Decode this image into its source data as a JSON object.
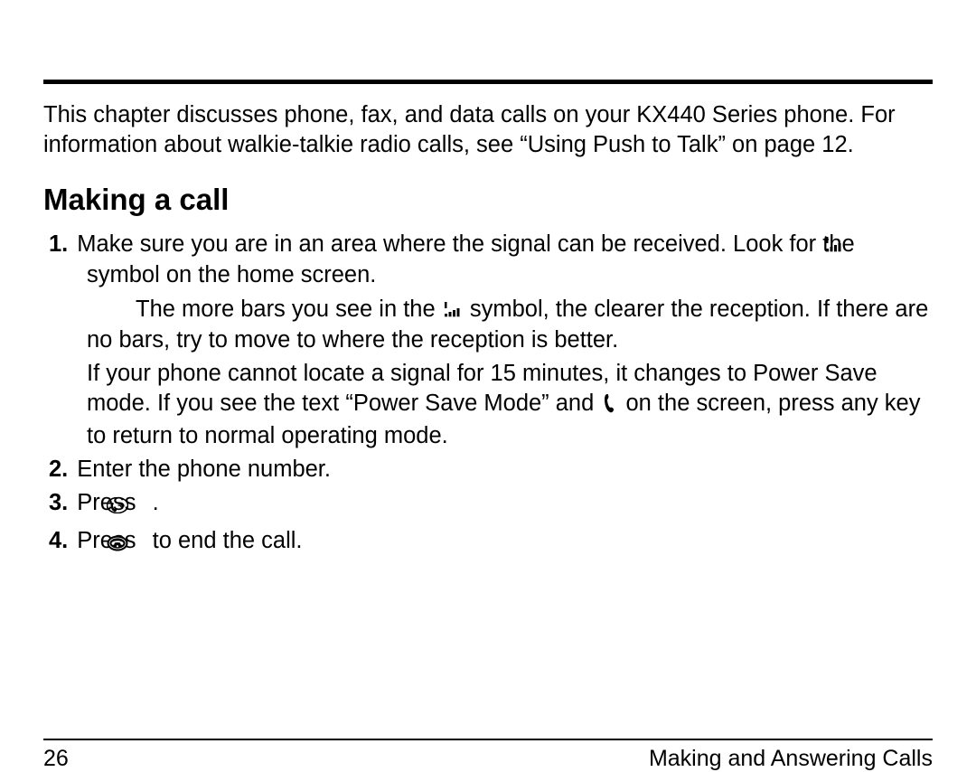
{
  "intro": "This chapter discusses phone, fax, and data calls on your KX440 Series phone. For information about walkie-talkie radio calls, see “Using Push to Talk” on page 12.",
  "heading": "Making a call",
  "steps": {
    "s1": {
      "num": "1.",
      "a": "Make sure you are in an area where the signal can be received. Look for the ",
      "b": " symbol on the home screen."
    },
    "sub1": {
      "lead": "The more bars you see in the ",
      "b": " symbol, the clearer the reception. If there are no bars, try to move to where the reception is better."
    },
    "sub2": {
      "a": "If your phone cannot locate a signal for 15 minutes, it changes to Power Save mode. If you see the text “Power Save Mode” and ",
      "b": " on the screen, press any key to return to normal operating mode."
    },
    "s2": {
      "num": "2.",
      "text": "Enter the phone number."
    },
    "s3": {
      "num": "3.",
      "a": "Press ",
      "b": " ."
    },
    "s4": {
      "num": "4.",
      "a": "Press ",
      "b": " to end the call."
    }
  },
  "footer": {
    "page": "26",
    "section": "Making and Answering Calls"
  }
}
